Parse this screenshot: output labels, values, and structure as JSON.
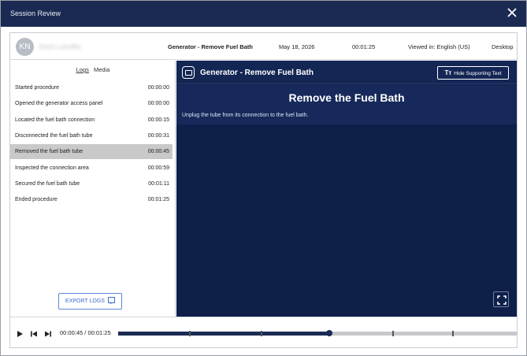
{
  "window": {
    "title": "Session Review"
  },
  "session": {
    "avatar_initials": "KN",
    "user_name": "Kevin Lutsoffer",
    "procedure": "Generator - Remove Fuel Bath",
    "date": "May 18, 2026",
    "duration": "00:01:25",
    "language": "Viewed in: English (US)",
    "device": "Desktop"
  },
  "tabs": {
    "logs": "Logs",
    "media": "Media"
  },
  "logs": [
    {
      "event": "Started procedure",
      "time": "00:00:00"
    },
    {
      "event": "Opened the generator access panel",
      "time": "00:00:00"
    },
    {
      "event": "Located the fuel bath connection",
      "time": "00:00:15"
    },
    {
      "event": "Disconnected the fuel bath tube",
      "time": "00:00:31"
    },
    {
      "event": "Removed the fuel bath tube",
      "time": "00:00:45",
      "selected": true
    },
    {
      "event": "Inspected the connection area",
      "time": "00:00:59"
    },
    {
      "event": "Secured the fuel bath tube",
      "time": "00:01:11"
    },
    {
      "event": "Ended procedure",
      "time": "00:01:25"
    }
  ],
  "export_label": "EXPORT LOGS",
  "viewer": {
    "header_title": "Generator - Remove Fuel Bath",
    "hide_text_label": "Hide Supporting Text",
    "step_title": "Remove the Fuel Bath",
    "step_description": "Unplug the tube from its connection to the fuel bath."
  },
  "playback": {
    "time_display": "00:00:45 / 00:01:25",
    "progress": 0.53,
    "marker_fractions": [
      0.18,
      0.36,
      0.53,
      0.69,
      0.84
    ]
  },
  "colors": {
    "header_bg": "#1b2a52",
    "viewer_bg": "#0e1f4a",
    "selected_row": "#c9c9c9",
    "accent_link": "#3a6bd0"
  },
  "icons": [
    "close-icon",
    "procedure-icon",
    "text-size-icon",
    "download-icon",
    "fullscreen-icon",
    "play-icon",
    "skip-back-icon",
    "skip-forward-icon"
  ]
}
